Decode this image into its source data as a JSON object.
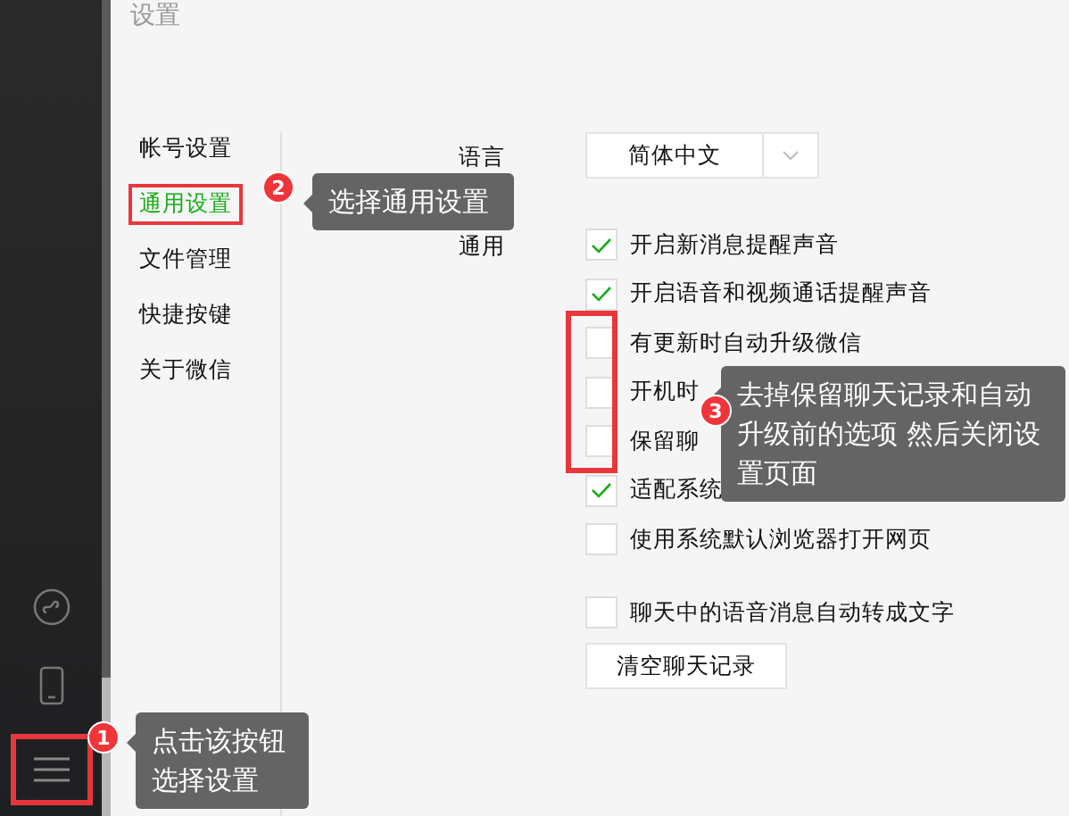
{
  "window": {
    "title": "设置"
  },
  "sidebar": {
    "items": [
      {
        "kind": "miniprogram"
      },
      {
        "kind": "phone"
      },
      {
        "kind": "menu",
        "highlighted": true
      }
    ]
  },
  "nav": [
    {
      "label": "帐号设置",
      "selected": false
    },
    {
      "label": "通用设置",
      "selected": true,
      "highlighted": true
    },
    {
      "label": "文件管理",
      "selected": false
    },
    {
      "label": "快捷按键",
      "selected": false
    },
    {
      "label": "关于微信",
      "selected": false
    }
  ],
  "language": {
    "label": "语言",
    "value": "简体中文"
  },
  "general": {
    "label": "通用",
    "options": [
      {
        "label": "开启新消息提醒声音",
        "checked": true,
        "highlighted": false
      },
      {
        "label": "开启语音和视频通话提醒声音",
        "checked": true,
        "highlighted": false
      },
      {
        "label": "有更新时自动升级微信",
        "checked": false,
        "highlighted": true
      },
      {
        "label": "开机时",
        "checked": false,
        "highlighted": true
      },
      {
        "label": "保留聊",
        "checked": false,
        "highlighted": true
      },
      {
        "label": "适配系统",
        "checked": true,
        "highlighted": false
      },
      {
        "label": "使用系统默认浏览器打开网页",
        "checked": false,
        "highlighted": false
      },
      {
        "label": "聊天中的语音消息自动转成文字",
        "checked": false,
        "highlighted": false
      }
    ]
  },
  "clear_button": "清空聊天记录",
  "annotations": [
    {
      "number": "1",
      "text": "点击该按钮选择设置"
    },
    {
      "number": "2",
      "text": "选择通用设置"
    },
    {
      "number": "3",
      "text": "去掉保留聊天记录和自动升级前的选项 然后关闭设置页面"
    }
  ]
}
